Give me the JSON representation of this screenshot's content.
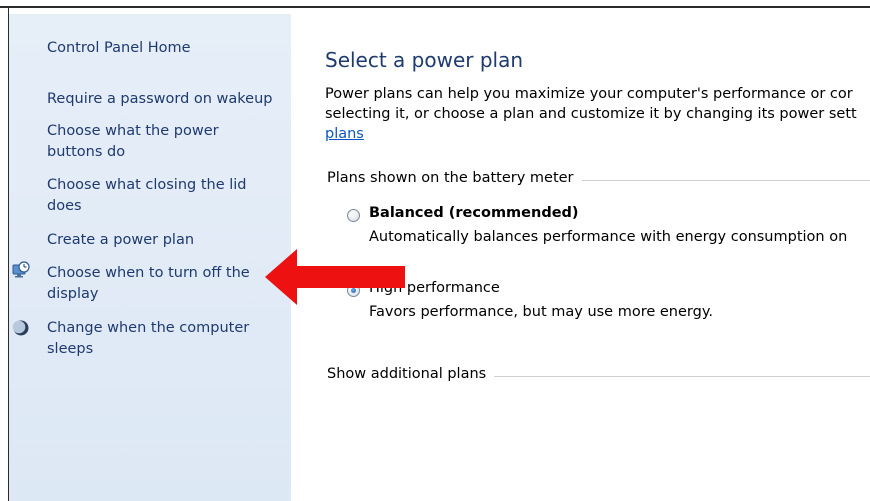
{
  "sidebar": {
    "home": "Control Panel Home",
    "links": [
      {
        "label": "Require a password on wakeup",
        "icon": null
      },
      {
        "label": "Choose what the power buttons do",
        "icon": null
      },
      {
        "label": "Choose what closing the lid does",
        "icon": null
      },
      {
        "label": "Create a power plan",
        "icon": null
      },
      {
        "label": "Choose when to turn off the display",
        "icon": "display-clock-icon"
      },
      {
        "label": "Change when the computer sleeps",
        "icon": "moon-icon"
      }
    ]
  },
  "main": {
    "title": "Select a power plan",
    "description_line1": "Power plans can help you maximize your computer's performance or cor",
    "description_line2": "selecting it, or choose a plan and customize it by changing its power sett",
    "description_link": "plans",
    "plans_section_label": "Plans shown on the battery meter",
    "plans": [
      {
        "name": "Balanced (recommended)",
        "description": "Automatically balances performance with energy consumption on",
        "selected": false
      },
      {
        "name": "High performance",
        "description": "Favors performance, but may use more energy.",
        "selected": true
      }
    ],
    "additional_label": "Show additional plans"
  },
  "colors": {
    "sidebar_bg": "#e3ecf7",
    "link": "#1e3a6e",
    "hyperlink": "#0b56c1",
    "arrow": "#ee1111"
  }
}
